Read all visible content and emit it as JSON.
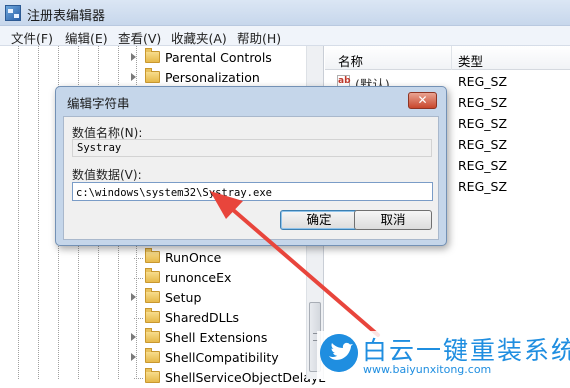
{
  "window": {
    "title": "注册表编辑器"
  },
  "menu": [
    "文件(F)",
    "编辑(E)",
    "查看(V)",
    "收藏夹(A)",
    "帮助(H)"
  ],
  "tree": {
    "items_top": [
      "Parental Controls",
      "Personalization"
    ],
    "items_bottom": [
      "RunOnce",
      "runonceEx",
      "Setup",
      "SharedDLLs",
      "Shell Extensions",
      "ShellCompatibility",
      "ShellServiceObjectDelayL"
    ]
  },
  "list": {
    "col_name": "名称",
    "col_type": "类型",
    "rows": [
      {
        "name": "(默认)",
        "type": "REG_SZ"
      },
      {
        "name": "",
        "type": "REG_SZ"
      },
      {
        "name": "",
        "type": "REG_SZ"
      },
      {
        "name": "",
        "type": "REG_SZ"
      },
      {
        "name": "",
        "type": "REG_SZ"
      },
      {
        "name": "",
        "type": "REG_SZ"
      }
    ]
  },
  "dialog": {
    "title": "编辑字符串",
    "close": "✕",
    "name_label": "数值名称(N):",
    "name_value": "Systray",
    "data_label": "数值数据(V):",
    "data_value": "c:\\windows\\system32\\Systray.exe",
    "ok": "确定",
    "cancel": "取消"
  },
  "watermark": {
    "title": "白云一键重装系统",
    "url": "www.baiyunxitong.com"
  },
  "colors": {
    "arrow": "#e8453c",
    "brand": "#1f8ee0"
  }
}
